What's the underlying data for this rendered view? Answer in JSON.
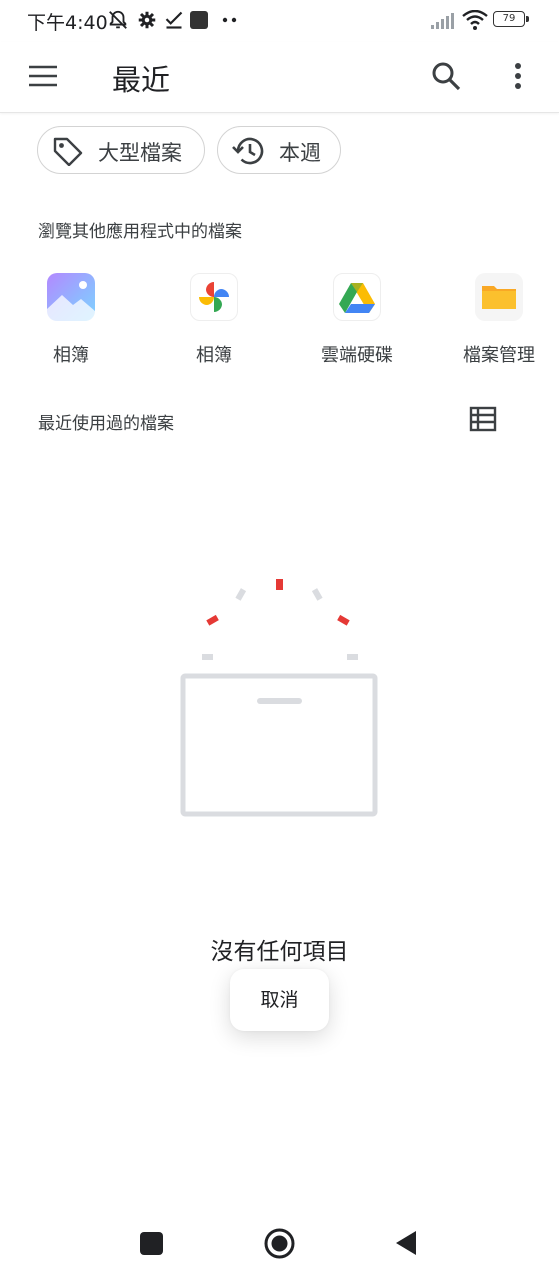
{
  "status_bar": {
    "time": "下午4:40",
    "battery": "79",
    "icons": [
      "mute-bell-icon",
      "gear-icon",
      "check-icon",
      "app-square-icon",
      "more-dots-icon",
      "signal-icon",
      "wifi-icon",
      "battery-icon"
    ]
  },
  "app_bar": {
    "title": "最近",
    "icons": [
      "menu-icon",
      "search-icon",
      "more-vert-icon"
    ]
  },
  "chips": [
    {
      "label": "大型檔案",
      "icon": "tag-icon"
    },
    {
      "label": "本週",
      "icon": "history-icon"
    }
  ],
  "browse_section": {
    "title": "瀏覽其他應用程式中的檔案",
    "apps": [
      {
        "label": "相簿",
        "icon": "gallery-icon"
      },
      {
        "label": "相簿",
        "icon": "google-photos-icon"
      },
      {
        "label": "雲端硬碟",
        "icon": "google-drive-icon"
      },
      {
        "label": "檔案管理",
        "icon": "folder-icon"
      }
    ]
  },
  "recent_section": {
    "title": "最近使用過的檔案",
    "view_toggle_icon": "list-view-icon"
  },
  "empty_state": {
    "text": "沒有任何項目",
    "illustration": "empty-box-icon"
  },
  "toast": {
    "label": "取消"
  },
  "nav_bar": {
    "icons": [
      "recents-square-icon",
      "home-circle-icon",
      "back-triangle-icon"
    ]
  },
  "colors": {
    "accent_red": "#e53935",
    "divider": "#e6e6e6",
    "chip_border": "#d3d3d3",
    "illustration_gray": "#dadce0"
  }
}
